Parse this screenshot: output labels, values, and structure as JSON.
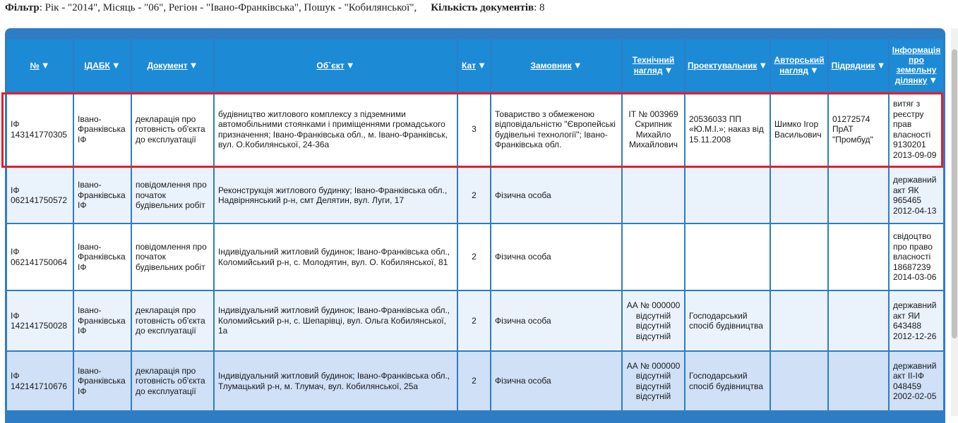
{
  "filter": {
    "filter_label": "Фільтр",
    "filter_text": ": Рік - \"2014\", Місяць - \"06\", Регіон - \"Івано-Франківська\", Пошук - \"Кобилянської\",",
    "count_label": "Кількість документів",
    "count_value": ": 8"
  },
  "table": {
    "headers": [
      "№",
      "ІДАБК",
      "Документ",
      "Об`єкт",
      "Кат",
      "Замовник",
      "Технічний нагляд",
      "Проектувальник",
      "Авторський нагляд",
      "Підрядник",
      "Інформація про земельну ділянку"
    ],
    "rows": [
      [
        "ІФ 143141770305",
        "Івано-Франківська ІФ",
        "декларація про готовність об'єкта до експлуатації",
        "будівництво житлового комплексу з підземними автомобільними стоянками і приміщеннями громадського призначення; Івано-Франківська обл., м. Івано-Франківськ, вул. О.Кобилянської, 24-36а",
        "3",
        "Товариство з обмеженою відповідальністю \"Європейські будівельні технології\"; Івано-Франківська обл.",
        "ІТ № 003969 Скрипник Михайло Михайлович",
        "20536033 ПП «Ю.М.І.»; наказ від 15.11.2008",
        "Шимко Ігор Васильович",
        "01272574 ПрАТ \"Промбуд\"",
        "витяг з реєстру прав власності 9130201 2013-09-09"
      ],
      [
        "ІФ 062141750572",
        "Івано-Франківська ІФ",
        "повідомлення про початок будівельних робіт",
        "Реконструкція житлового будинку; Івано-Франківська обл., Надвірнянський р-н, смт Делятин, вул. Луги, 17",
        "2",
        "Фізична особа",
        "",
        "",
        "",
        "",
        "державний акт ЯК 965465 2012-04-13"
      ],
      [
        "ІФ 062141750064",
        "Івано-Франківська ІФ",
        "повідомлення про початок будівельних робіт",
        "Індивідуальний житловий будинок; Івано-Франківська обл., Коломийський р-н, с. Молодятин, вул. О. Кобилянської, 81",
        "2",
        "Фізична особа",
        "",
        "",
        "",
        "",
        "свідоцтво про право власності 18687239 2014-03-06"
      ],
      [
        "ІФ 142141750028",
        "Івано-Франківська ІФ",
        "декларація про готовність об'єкта до експлуатації",
        "Індивідуальний житловий будинок; Івано-Франківська обл., Коломийський р-н, с. Шепарівці, вул. Ольга Кобилянської, 1а",
        "2",
        "Фізична особа",
        "АА № 000000 відсутній відсутній відсутній",
        "Господарський спосіб будівництва",
        "",
        "",
        "державний акт ЯИ 643488 2012-12-26"
      ],
      [
        "ІФ 142141710676",
        "Івано-Франківська ІФ",
        "декларація про готовність об'єкта до експлуатації",
        "Індивідуальний житловий будинок; Івано-Франківська обл., Тлумацький р-н, м. Тлумач, вул. Кобилянської, 25а",
        "2",
        "Фізична особа",
        "АА № 000000 відсутній відсутній відсутній",
        "Господарський спосіб будівництва",
        "",
        "",
        "державний акт ІІ-ІФ 048459 2002-02-05"
      ]
    ]
  },
  "colors": {
    "header_bg": "#1d8ad6",
    "frame": "#2e7dc4",
    "highlight": "#e0202a"
  }
}
